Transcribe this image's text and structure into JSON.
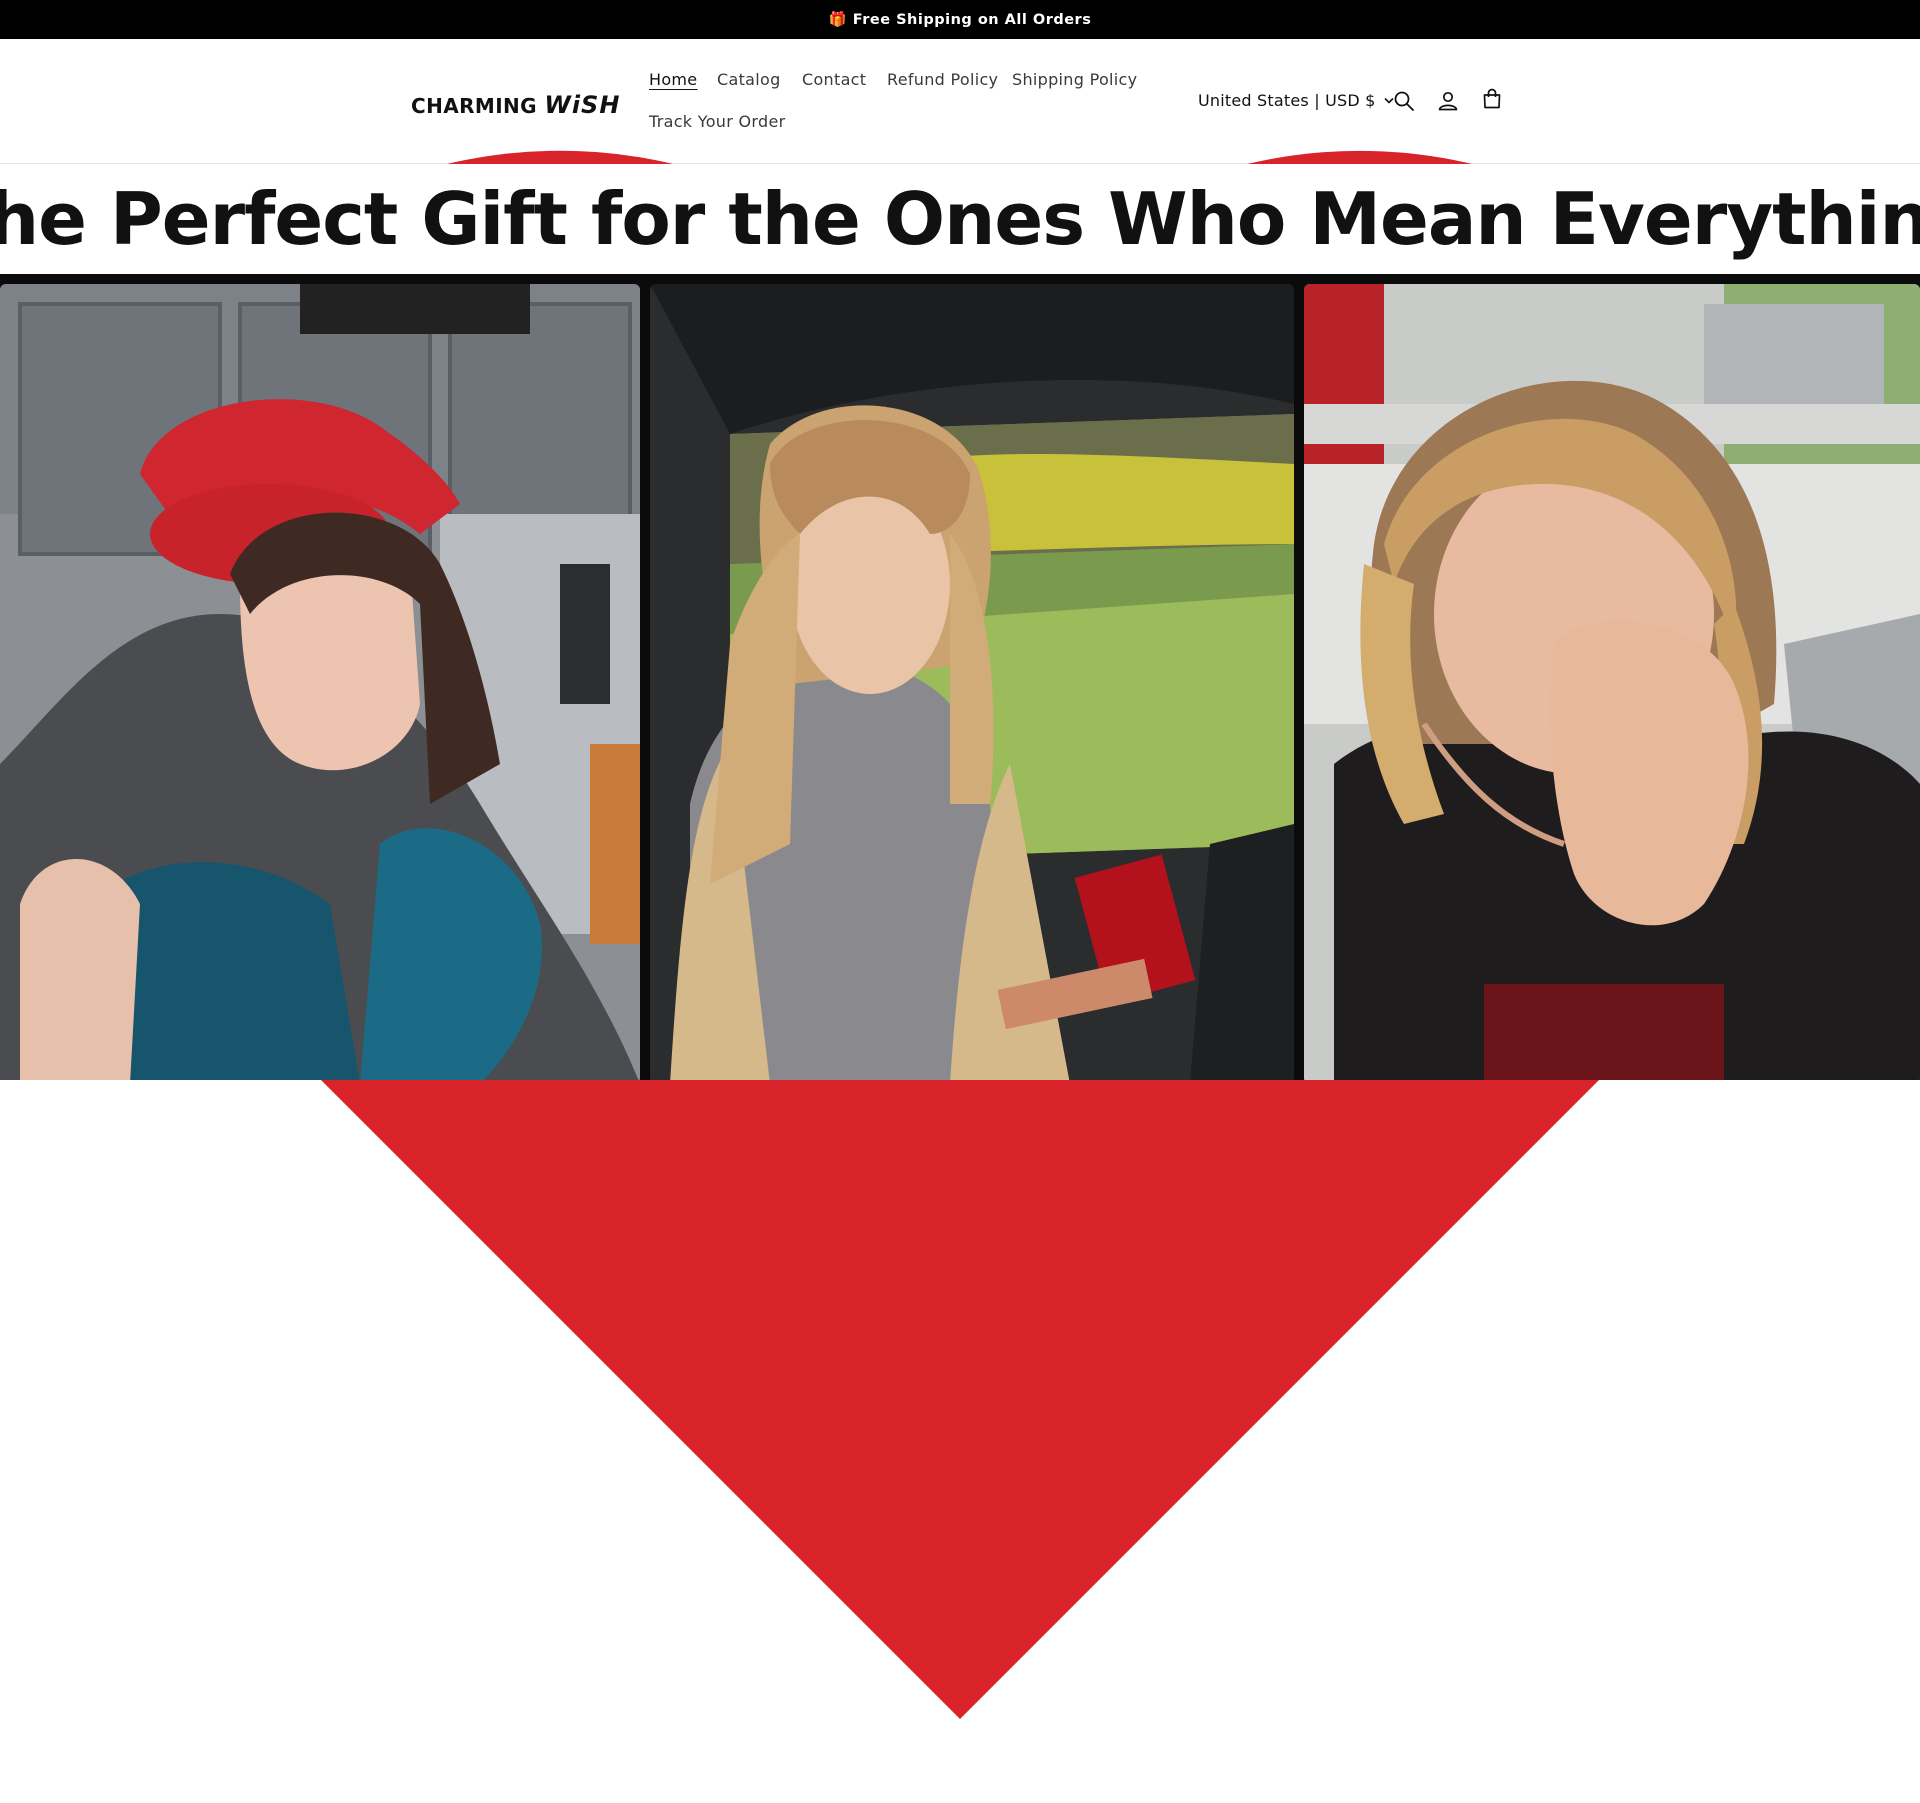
{
  "announcement": {
    "icon": "gift-icon",
    "text": "🎁 Free Shipping on All Orders"
  },
  "header": {
    "logo_text_a": "CHARMING ",
    "logo_text_b": "WiSH",
    "nav": [
      {
        "label": "Home",
        "active": true
      },
      {
        "label": "Catalog"
      },
      {
        "label": "Contact"
      },
      {
        "label": "Refund Policy"
      },
      {
        "label": "Shipping Policy"
      },
      {
        "label": "Track Your Order"
      }
    ],
    "country_selector": "United States | USD $",
    "icons": [
      "search-icon",
      "account-icon",
      "cart-icon"
    ]
  },
  "hero": {
    "title": "The Perfect Gift for the Ones Who Mean Everything",
    "panels": [
      "hug-photo",
      "car-surprise-photo",
      "tearful-reaction-photo"
    ]
  },
  "colors": {
    "announcement_bg": "#000000",
    "heart": "#d8232a",
    "gift": "#e8743b"
  }
}
